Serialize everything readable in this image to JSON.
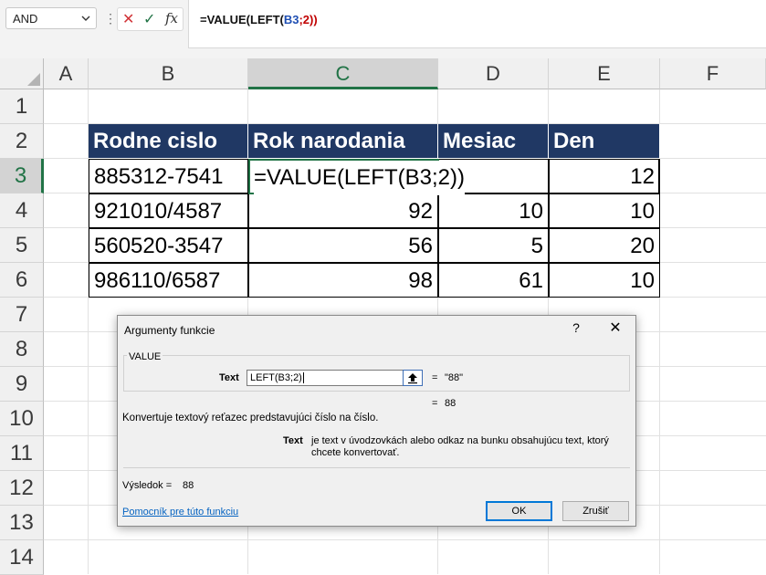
{
  "namebox": {
    "value": "AND"
  },
  "formula_bar": {
    "cancel_symbol": "✕",
    "enter_symbol": "✓",
    "fx_label": "fx",
    "formula_prefix": "=VALUE(LEFT(",
    "formula_ref": "B3",
    "formula_sep": ";2",
    "formula_close": "))"
  },
  "columns": [
    "A",
    "B",
    "C",
    "D",
    "E",
    "F"
  ],
  "selected_column": "C",
  "rows": [
    "1",
    "2",
    "3",
    "4",
    "5",
    "6",
    "7",
    "8",
    "9",
    "10",
    "11",
    "12",
    "13",
    "14"
  ],
  "selected_row": "3",
  "table": {
    "headers": [
      "Rodne cislo",
      "Rok narodania",
      "Mesiac",
      "Den"
    ],
    "rows": [
      [
        "885312-7541",
        "=VALUE(LEFT(B3;2))",
        "",
        "12"
      ],
      [
        "921010/4587",
        "92",
        "10",
        "10"
      ],
      [
        "560520-3547",
        "56",
        "5",
        "20"
      ],
      [
        "986110/6587",
        "98",
        "61",
        "10"
      ]
    ]
  },
  "dialog": {
    "title": "Argumenty funkcie",
    "help_symbol": "?",
    "close_symbol": "✕",
    "function_name": "VALUE",
    "arg_label": "Text",
    "arg_value": "LEFT(B3;2)",
    "arg_eq": "=",
    "arg_result": "\"88\"",
    "func_eq": "=",
    "func_result": "88",
    "description": "Konvertuje textový reťazec predstavujúci číslo na číslo.",
    "help_label": "Text",
    "help_text": "je text v úvodzovkách alebo odkaz na bunku obsahujúcu text, ktorý chcete konvertovať.",
    "result_label": "Výsledok =",
    "result_value": "88",
    "help_link": "Pomocník pre túto funkciu",
    "ok_label": "OK",
    "cancel_label": "Zrušiť"
  },
  "colors": {
    "header_fill": "#203864",
    "selection_green": "#217346",
    "link_blue": "#0563c1"
  }
}
